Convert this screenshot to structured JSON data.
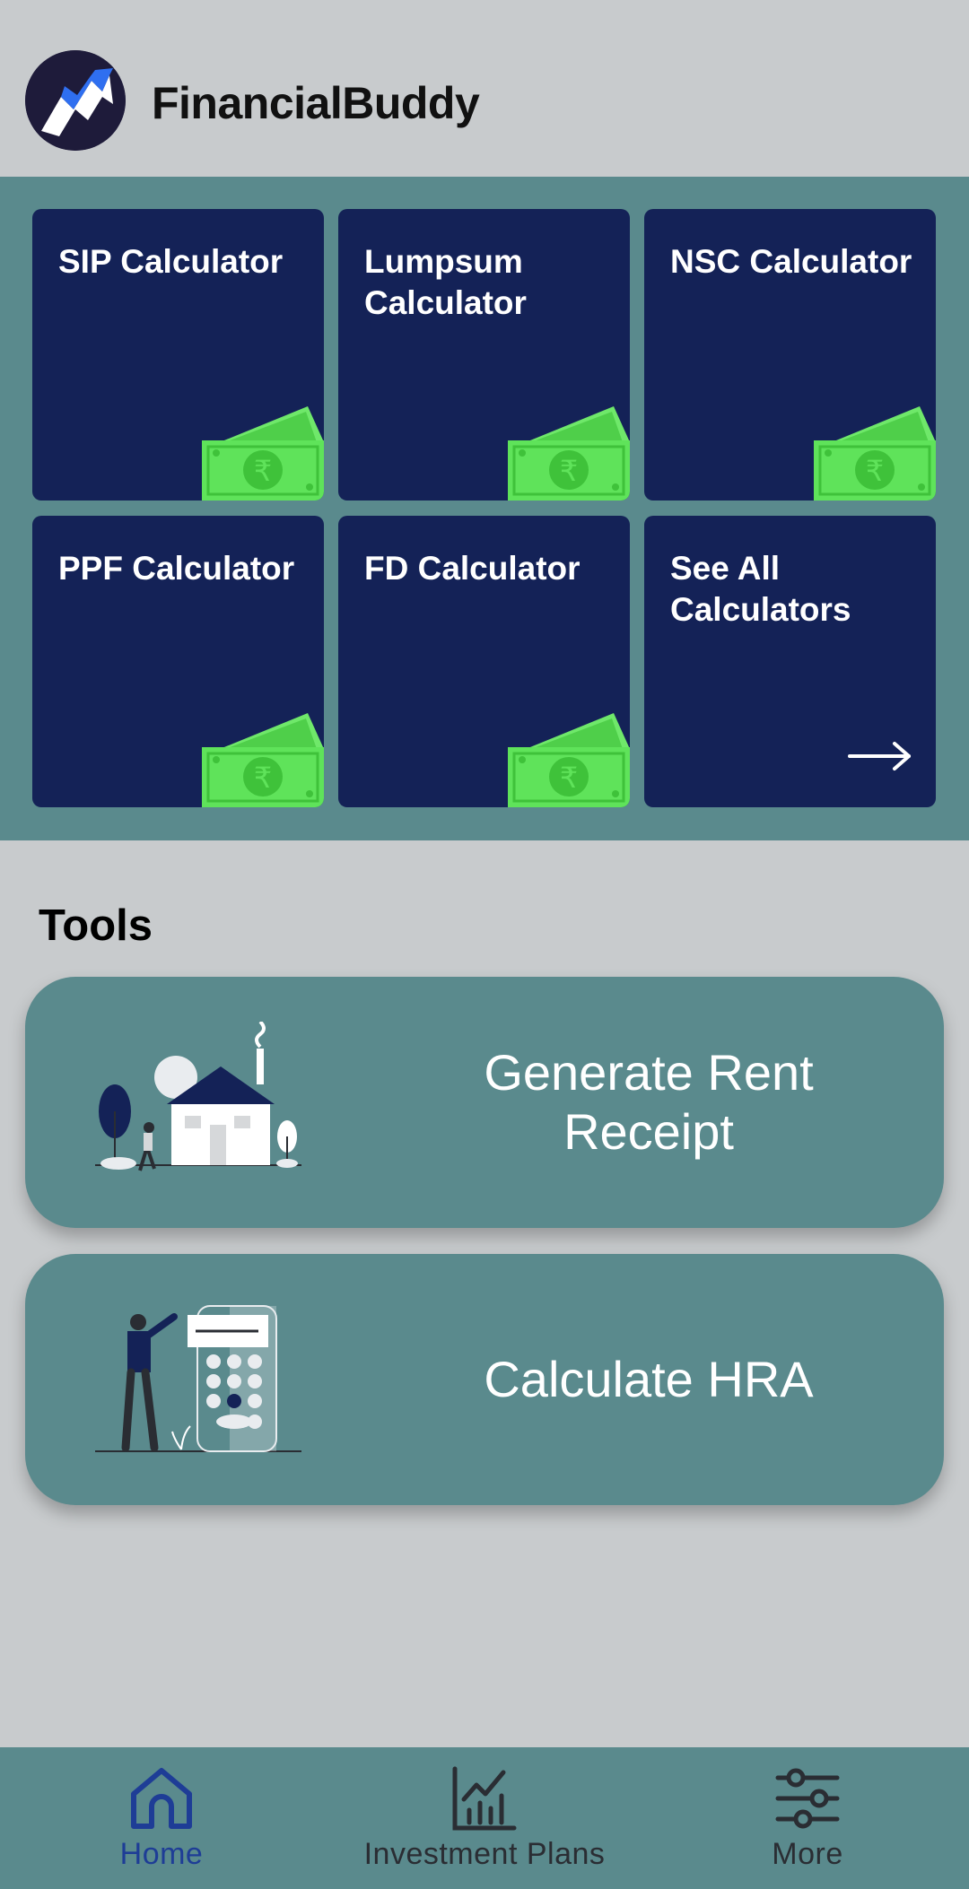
{
  "app": {
    "title": "FinancialBuddy"
  },
  "calculators": [
    {
      "label": "SIP Calculator",
      "icon": "money-icon"
    },
    {
      "label": "Lumpsum Calculator",
      "icon": "money-icon"
    },
    {
      "label": "NSC Calculator",
      "icon": "money-icon"
    },
    {
      "label": "PPF Calculator",
      "icon": "money-icon"
    },
    {
      "label": "FD Calculator",
      "icon": "money-icon"
    },
    {
      "label": "See All Calculators",
      "icon": "arrow-right-icon"
    }
  ],
  "tools": {
    "title": "Tools",
    "items": [
      {
        "label": "Generate Rent Receipt",
        "icon": "house-illustration-icon"
      },
      {
        "label": "Calculate HRA",
        "icon": "calculator-illustration-icon"
      }
    ]
  },
  "nav": {
    "items": [
      {
        "label": "Home",
        "icon": "home-icon",
        "active": true
      },
      {
        "label": "Investment Plans",
        "icon": "chart-icon",
        "active": false
      },
      {
        "label": "More",
        "icon": "sliders-icon",
        "active": false
      }
    ]
  },
  "colors": {
    "background": "#c8cbcd",
    "panel": "#5a8a8d",
    "card": "#142257",
    "money": "#5fe35a",
    "active_nav": "#1e3d96"
  }
}
